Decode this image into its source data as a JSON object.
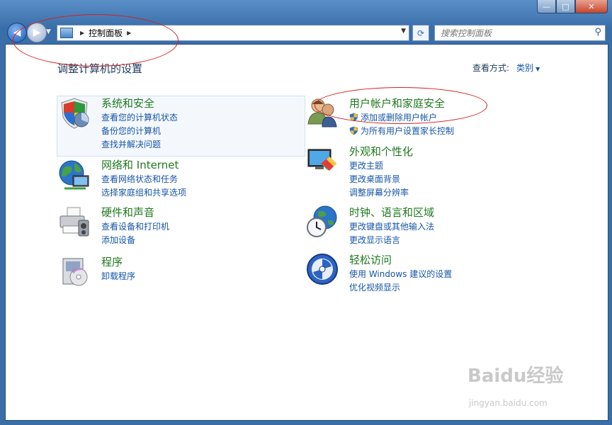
{
  "window": {
    "min_glyph": "—",
    "max_glyph": "□",
    "close_glyph": "✕"
  },
  "nav": {
    "address_segments": [
      "控制面板"
    ],
    "search_placeholder": "搜索控制面板"
  },
  "page": {
    "heading": "调整计算机的设置",
    "view_by_label": "查看方式:",
    "view_by_value": "类别"
  },
  "categories": [
    {
      "title": "系统和安全",
      "icon": "shield-icon",
      "links": [
        "查看您的计算机状态",
        "备份您的计算机",
        "查找并解决问题"
      ]
    },
    {
      "title": "网络和 Internet",
      "icon": "globe-network-icon",
      "links": [
        "查看网络状态和任务",
        "选择家庭组和共享选项"
      ]
    },
    {
      "title": "硬件和声音",
      "icon": "printer-icon",
      "links": [
        "查看设备和打印机",
        "添加设备"
      ]
    },
    {
      "title": "程序",
      "icon": "programs-icon",
      "links": [
        "卸载程序"
      ]
    },
    {
      "title": "用户帐户和家庭安全",
      "icon": "users-icon",
      "links": [
        "添加或删除用户帐户",
        "为所有用户设置家长控制"
      ]
    },
    {
      "title": "外观和个性化",
      "icon": "monitor-paint-icon",
      "links": [
        "更改主题",
        "更改桌面背景",
        "调整屏幕分辨率"
      ]
    },
    {
      "title": "时钟、语言和区域",
      "icon": "clock-globe-icon",
      "links": [
        "更改键盘或其他输入法",
        "更改显示语言"
      ]
    },
    {
      "title": "轻松访问",
      "icon": "accessibility-icon",
      "links": [
        "使用 Windows 建议的设置",
        "优化视频显示"
      ]
    }
  ],
  "watermark": {
    "brand": "Baidu经验",
    "url": "jingyan.baidu.com"
  }
}
